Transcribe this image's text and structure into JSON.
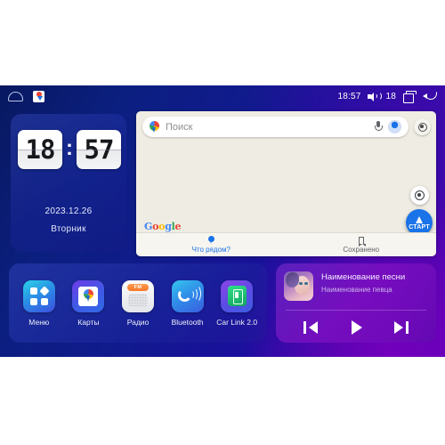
{
  "statusbar": {
    "home_icon": "home-icon",
    "maps_icon": "google-maps-icon",
    "time": "18:57",
    "volume_icon": "speaker-icon",
    "volume_level": "18",
    "recents_icon": "recents-icon",
    "back_icon": "back-icon"
  },
  "clock": {
    "hours": "18",
    "separator": ":",
    "minutes": "57",
    "date": "2023.12.26",
    "weekday": "Вторник"
  },
  "maps": {
    "search_placeholder": "Поиск",
    "pin_icon": "google-maps-pin-icon",
    "mic_icon": "microphone-icon",
    "avatar_icon": "account-avatar",
    "layers_icon": "map-settings-icon",
    "compass_icon": "recenter-compass-icon",
    "start_label": "СТАРТ",
    "google_logo": [
      "G",
      "o",
      "o",
      "g",
      "l",
      "e"
    ],
    "tabs": [
      {
        "label": "Что рядом?",
        "icon": "pin-icon",
        "active": true
      },
      {
        "label": "Сохранено",
        "icon": "bookmark-icon",
        "active": false
      }
    ]
  },
  "dock": {
    "apps": [
      {
        "label": "Меню",
        "icon": "menu-grid-icon"
      },
      {
        "label": "Карты",
        "icon": "maps-icon"
      },
      {
        "label": "Радио",
        "icon": "radio-icon",
        "band": "FM"
      },
      {
        "label": "Bluetooth",
        "icon": "bluetooth-headset-icon"
      },
      {
        "label": "Car Link 2.0",
        "icon": "car-link-icon"
      }
    ]
  },
  "music": {
    "album_art": "album-art-woman-portrait",
    "title": "Наименование песни",
    "artist": "Наименование певца",
    "controls": [
      {
        "name": "previous-track",
        "icon": "skip-previous-icon"
      },
      {
        "name": "play",
        "icon": "play-icon"
      },
      {
        "name": "next-track",
        "icon": "skip-next-icon"
      }
    ]
  },
  "colors": {
    "bg_blue": "#111a8e",
    "bg_purple": "#5c00b4",
    "map_bg": "#efece3",
    "accent_blue": "#1a73e8"
  }
}
